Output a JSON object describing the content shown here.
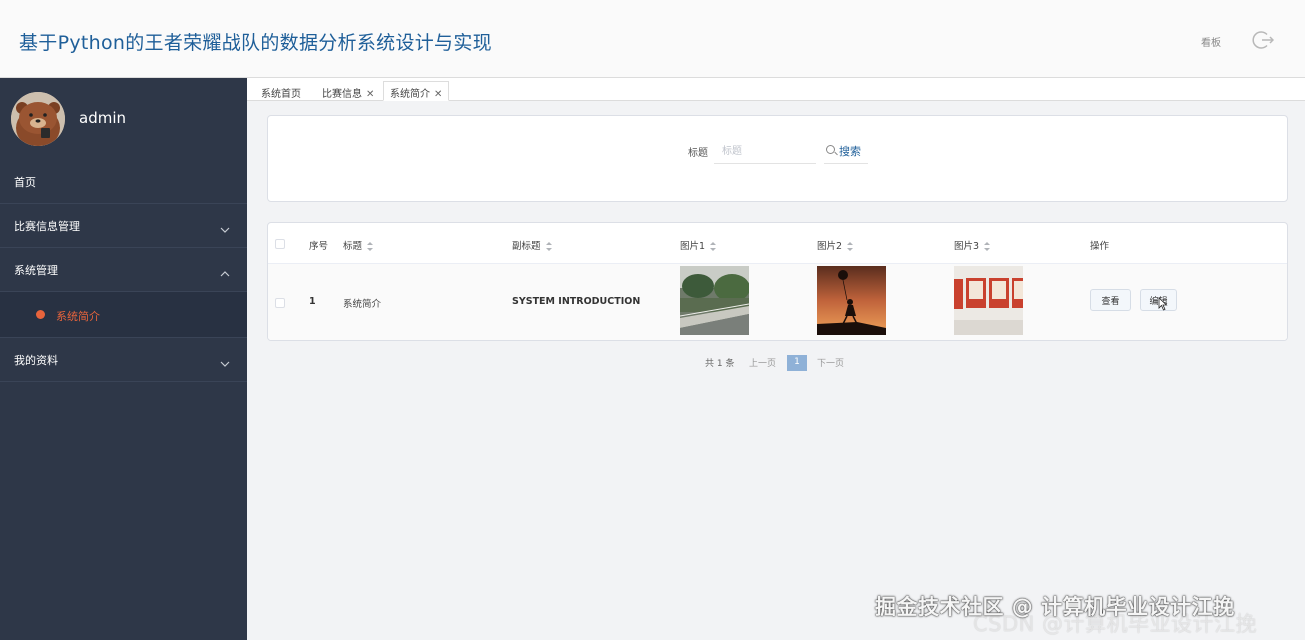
{
  "header": {
    "title": "基于Python的王者荣耀战队的数据分析系统设计与实现",
    "dashboard_link": "看板",
    "logout_icon": "logout-icon"
  },
  "sidebar": {
    "username": "admin",
    "items": [
      {
        "label": "首页",
        "expanded": false
      },
      {
        "label": "比赛信息管理",
        "expanded": false
      },
      {
        "label": "系统管理",
        "expanded": true,
        "children": [
          {
            "label": "系统简介",
            "active": true
          }
        ]
      },
      {
        "label": "我的资料",
        "expanded": false
      }
    ]
  },
  "tabs": [
    {
      "label": "系统首页",
      "closable": false
    },
    {
      "label": "比赛信息",
      "closable": true
    },
    {
      "label": "系统简介",
      "closable": true,
      "active": true
    }
  ],
  "search": {
    "label": "标题",
    "placeholder": "标题",
    "button": "搜索"
  },
  "table": {
    "columns": [
      "序号",
      "标题",
      "副标题",
      "图片1",
      "图片2",
      "图片3",
      "操作"
    ],
    "rows": [
      {
        "index": "1",
        "title": "系统简介",
        "subtitle": "SYSTEM INTRODUCTION",
        "images": [
          "photo-park-walkway",
          "photo-girl-balloon-sunset",
          "photo-posters-wall"
        ],
        "actions": [
          "查看",
          "编辑"
        ]
      }
    ]
  },
  "pagination": {
    "total": "共 1 条",
    "prev": "上一页",
    "current": "1",
    "next": "下一页"
  },
  "watermark": {
    "line1": "掘金技术社区 @ 计算机毕业设计江挽",
    "line2": "CSDN @计算机毕业设计江挽"
  },
  "colors": {
    "title": "#1f5f99",
    "sidebar_bg": "#2e3748",
    "active_item": "#e8643c",
    "page_active": "#8fb1d7"
  }
}
